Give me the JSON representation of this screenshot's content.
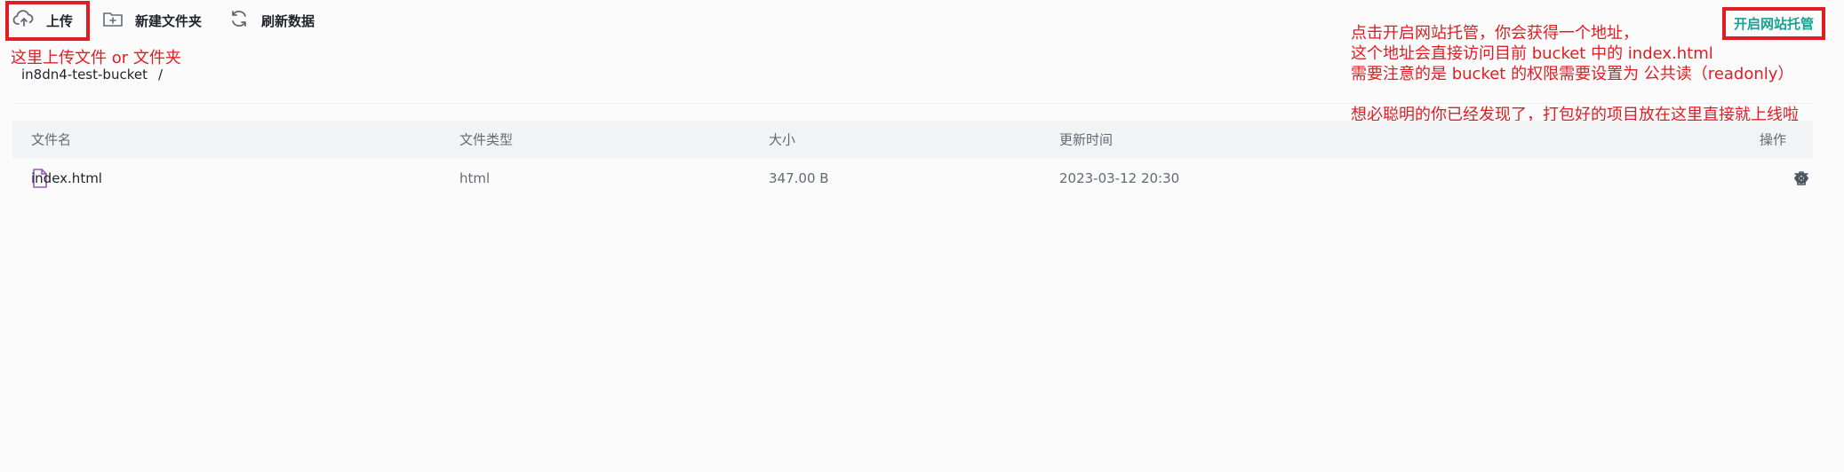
{
  "toolbar": {
    "upload_label": "上传",
    "new_folder_label": "新建文件夹",
    "refresh_label": "刷新数据",
    "hosting_label": "开启网站托管"
  },
  "annotations": {
    "upload_note": "这里上传文件 or 文件夹",
    "hosting_note_lines": [
      "点击开启网站托管，你会获得一个地址，",
      "这个地址会直接访问目前 bucket 中的 index.html",
      "需要注意的是 bucket 的权限需要设置为 公共读（readonly）",
      "想必聪明的你已经发现了，打包好的项目放在这里直接就上线啦"
    ],
    "color": "#e01d22"
  },
  "breadcrumb": {
    "bucket": "in8dn4-test-bucket",
    "separator": "/"
  },
  "table": {
    "headers": [
      "文件名",
      "文件类型",
      "大小",
      "更新时间",
      "操作"
    ],
    "rows": [
      {
        "name": "index.html",
        "type": "html",
        "size": "347.00 B",
        "updated": "2023-03-12 20:30"
      }
    ]
  },
  "icons": {
    "upload": "cloud-upload-icon",
    "new_folder": "folder-add-icon",
    "refresh": "refresh-icon",
    "file": "file-icon",
    "preview": "eye-icon",
    "delete": "trash-icon"
  },
  "colors": {
    "accent": "#1aa192",
    "file_icon": "#9b59b6",
    "annotation": "#e01d22"
  }
}
